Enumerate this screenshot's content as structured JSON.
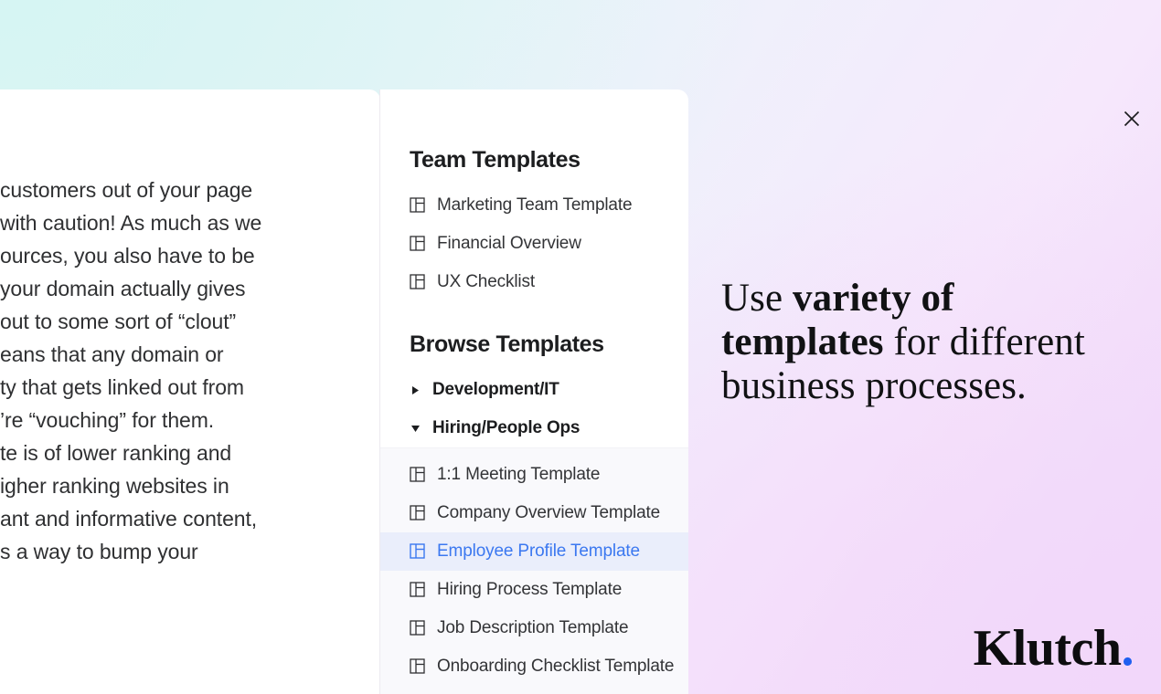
{
  "theme": {
    "accent_blue": "#3b78f0",
    "brand_dot": "#1f5ff0",
    "selected_row_bg": "#eaeefb",
    "sub_list_bg": "#f9f9fc",
    "backdrop_cyan": "#d6f5f3",
    "backdrop_pink": "#f2d7fa",
    "text_primary": "#1c1d1f",
    "text_body": "#333437"
  },
  "article": {
    "lines": [
      "customers out of your page",
      "with caution! As much as we",
      "ources, you also have to be",
      "your domain actually gives",
      "out to some sort of “clout”",
      "eans that any domain or",
      "ty that gets linked out from",
      "’re “vouching” for them.",
      "te is of lower ranking and",
      "igher ranking websites in",
      "ant and informative content,",
      "s a way to bump your"
    ]
  },
  "panel": {
    "close_label": "×",
    "close_icon": "close-icon",
    "team_section": {
      "title": "Team Templates",
      "items": [
        {
          "label": "Marketing Team Template",
          "icon": "table-grid-icon"
        },
        {
          "label": "Financial Overview",
          "icon": "table-grid-icon"
        },
        {
          "label": "UX Checklist",
          "icon": "table-grid-icon"
        }
      ]
    },
    "browse_section": {
      "title": "Browse Templates",
      "groups": [
        {
          "label": "Development/IT",
          "expanded": false,
          "caret_icon": "chevron-right-icon",
          "items": []
        },
        {
          "label": "Hiring/People Ops",
          "expanded": true,
          "caret_icon": "chevron-down-icon",
          "items": [
            {
              "label": "1:1 Meeting Template",
              "icon": "table-grid-icon",
              "selected": false
            },
            {
              "label": "Company Overview Template",
              "icon": "table-grid-icon",
              "selected": false
            },
            {
              "label": "Employee Profile Template",
              "icon": "table-grid-icon",
              "selected": true
            },
            {
              "label": "Hiring Process Template",
              "icon": "table-grid-icon",
              "selected": false
            },
            {
              "label": "Job Description Template",
              "icon": "table-grid-icon",
              "selected": false
            },
            {
              "label": "Onboarding Checklist Template",
              "icon": "table-grid-icon",
              "selected": false
            }
          ]
        }
      ]
    }
  },
  "promo": {
    "headline_part1": "Use ",
    "headline_bold": "variety of templates",
    "headline_part2": " for different business processes."
  },
  "brand": {
    "name": "Klutch",
    "dot": "."
  }
}
